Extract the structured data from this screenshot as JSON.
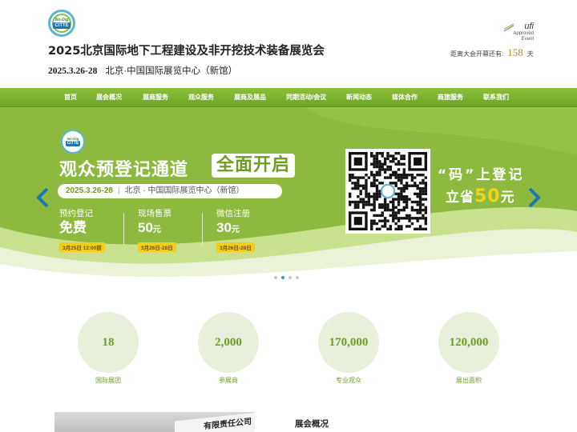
{
  "header": {
    "logo": {
      "line1": "No-Dig",
      "line2": "CITTE"
    },
    "title": "2025北京国际地下工程建设及非开挖技术装备展览会",
    "date": "2025.3.26-28",
    "venue": "北京·中国国际展览中心（新馆）",
    "ufi": {
      "brand": "ufi",
      "line1": "Approved",
      "line2": "Event"
    },
    "countdown": {
      "prefix": "距离大会开幕还有:",
      "days": "158",
      "suffix": "天"
    }
  },
  "nav": {
    "items": [
      "首页",
      "展会概况",
      "展商服务",
      "观众服务",
      "展商及展品",
      "同期活动/会议",
      "新闻动态",
      "媒体合作",
      "商旅服务",
      "联系我们"
    ]
  },
  "banner": {
    "logo": {
      "line1": "No-Dig",
      "line2": "CITTE"
    },
    "headline": "观众预登记通道",
    "headline_highlight": "全面开启",
    "date": "2025.3.26-28",
    "sep": "|",
    "venue": "北京 · 中国国际展览中心（新馆）",
    "tickets": [
      {
        "label": "预约登记",
        "price": "免费",
        "unit": "",
        "tag": "3月25日 12:00前"
      },
      {
        "label": "现场售票",
        "price": "50",
        "unit": "元",
        "tag": "3月26日-28日"
      },
      {
        "label": "微信注册",
        "price": "30",
        "unit": "元",
        "tag": "3月26日-28日"
      }
    ],
    "promo_line1": "“码”上登记",
    "promo_line2_a": "立省",
    "promo_line2_num": "50",
    "promo_line2_b": "元",
    "slide_count": 4,
    "active_slide": 2,
    "colors": {
      "accent": "#6d9d25",
      "tag": "#f0cf1a",
      "arrow": "#1b77b5"
    }
  },
  "stats": [
    {
      "value": "18",
      "label": "国际展团"
    },
    {
      "value": "2,000",
      "label": "参展商"
    },
    {
      "value": "170,000",
      "label": "专业观众"
    },
    {
      "value": "120,000",
      "label": "展出面积"
    }
  ],
  "photo_sign": "有限责任公司",
  "overview_title": "展会概况"
}
